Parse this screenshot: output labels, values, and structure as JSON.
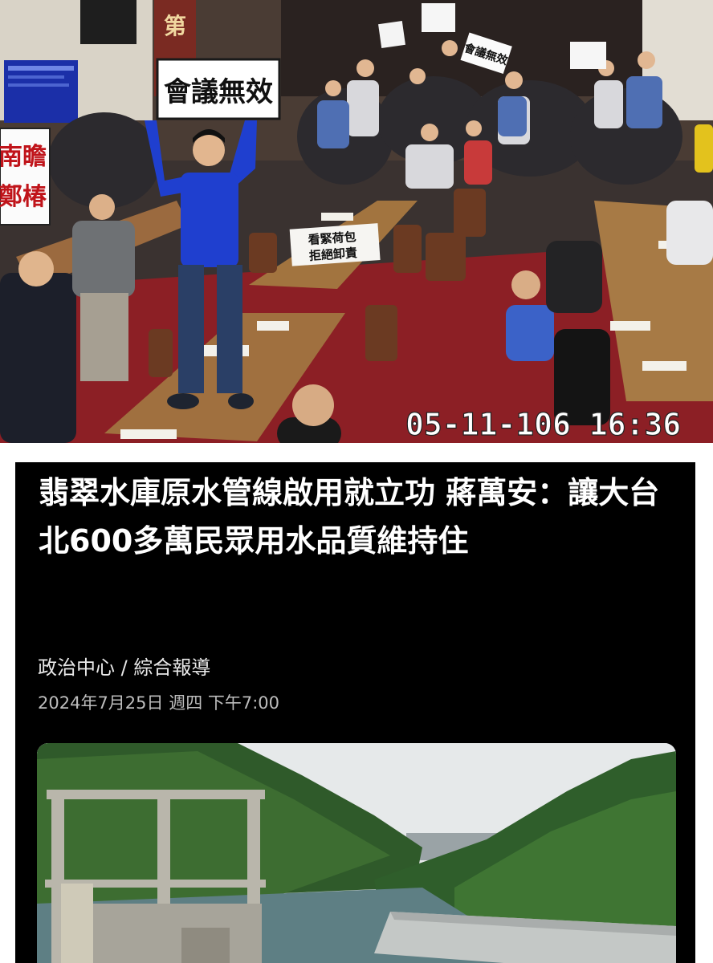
{
  "top_photo": {
    "main_sign": "會議無效",
    "left_banner": [
      "南瞻",
      "鄭椿"
    ],
    "table_sign": [
      "看緊荷包",
      "拒絕卸責"
    ],
    "pillar_sign": "第",
    "back_signs": [
      "會議無效"
    ],
    "timestamp": "05-11-106 16:36"
  },
  "article": {
    "headline": "翡翠水庫原水管線啟用就立功 蔣萬安：讓大台北600多萬民眾用水品質維持住",
    "byline": "政治中心 / 綜合報導",
    "dateline": "2024年7月25日 週四 下午7:00"
  },
  "colors": {
    "card_background": "#000000",
    "headline_text": "#ffffff",
    "carpet": "#8c1f25",
    "shirt_blue": "#1f3fcf"
  }
}
